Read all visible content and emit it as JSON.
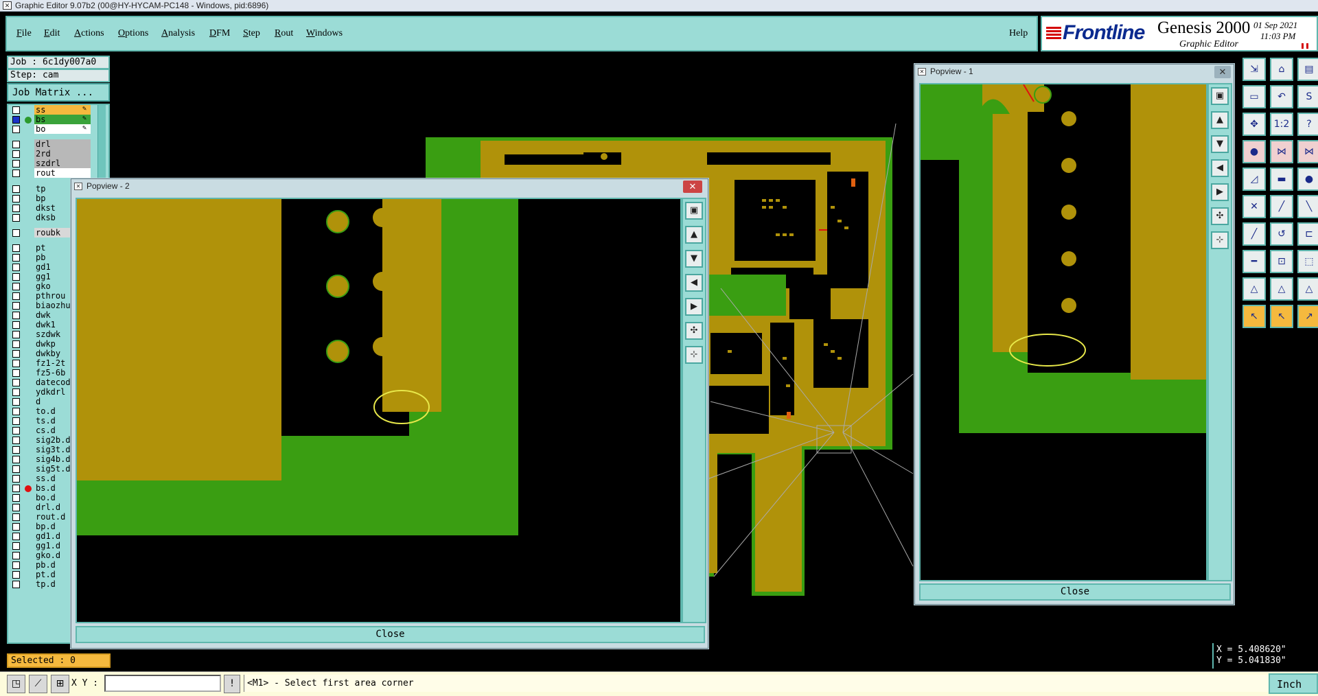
{
  "window": {
    "title": "Graphic Editor 9.07b2 (00@HY-HYCAM-PC148 - Windows, pid:6896)"
  },
  "menu": {
    "items": [
      {
        "label": "File",
        "u": "F",
        "rest": "ile"
      },
      {
        "label": "Edit",
        "u": "E",
        "rest": "dit"
      },
      {
        "label": "Actions",
        "u": "A",
        "rest": "ctions"
      },
      {
        "label": "Options",
        "u": "O",
        "rest": "ptions"
      },
      {
        "label": "Analysis",
        "u": "A",
        "rest": "nalysis"
      },
      {
        "label": "DFM",
        "u": "D",
        "rest": "FM"
      },
      {
        "label": "Step",
        "u": "S",
        "rest": "tep"
      },
      {
        "label": "Rout",
        "u": "R",
        "rest": "out"
      },
      {
        "label": "Windows",
        "u": "W",
        "rest": "indows"
      }
    ],
    "help": "Help"
  },
  "brand": {
    "logo": "Frontline",
    "product": "Genesis 2000",
    "subtitle": "Graphic Editor",
    "date": "01 Sep 2021",
    "time": "11:03 PM"
  },
  "job": {
    "job_line": "Job : 6c1dy007a0",
    "step_line": "Step: cam",
    "matrix_button": "Job Matrix ..."
  },
  "layers": [
    {
      "name": "ss",
      "bg": "#f5b93e",
      "dot": "",
      "edit": true
    },
    {
      "name": "bs",
      "bg": "#3aa33a",
      "dot": "#2c9a2c",
      "edit": true,
      "sel": true
    },
    {
      "name": "bo",
      "bg": "#ffffff",
      "dot": "",
      "edit": true
    },
    {
      "name": "drl",
      "bg": "#b8b8b8",
      "dot": ""
    },
    {
      "name": "2rd",
      "bg": "#b8b8b8",
      "dot": ""
    },
    {
      "name": "szdrl",
      "bg": "#b8b8b8",
      "dot": ""
    },
    {
      "name": "rout",
      "bg": "#ffffff",
      "dot": ""
    },
    {
      "name": "tp",
      "bg": "#9bdcd6",
      "dot": ""
    },
    {
      "name": "bp",
      "bg": "#9bdcd6",
      "dot": ""
    },
    {
      "name": "dkst",
      "bg": "#9bdcd6",
      "dot": ""
    },
    {
      "name": "dksb",
      "bg": "#9bdcd6",
      "dot": ""
    },
    {
      "name": "roubk",
      "bg": "#d8d8d8",
      "dot": ""
    },
    {
      "name": "pt",
      "bg": "#9bdcd6",
      "dot": ""
    },
    {
      "name": "pb",
      "bg": "#9bdcd6",
      "dot": ""
    },
    {
      "name": "gd1",
      "bg": "#9bdcd6",
      "dot": ""
    },
    {
      "name": "gg1",
      "bg": "#9bdcd6",
      "dot": ""
    },
    {
      "name": "gko",
      "bg": "#9bdcd6",
      "dot": ""
    },
    {
      "name": "pthrou",
      "bg": "#9bdcd6",
      "dot": ""
    },
    {
      "name": "biaozhu",
      "bg": "#9bdcd6",
      "dot": ""
    },
    {
      "name": "dwk",
      "bg": "#9bdcd6",
      "dot": ""
    },
    {
      "name": "dwk1",
      "bg": "#9bdcd6",
      "dot": ""
    },
    {
      "name": "szdwk",
      "bg": "#9bdcd6",
      "dot": ""
    },
    {
      "name": "dwkp",
      "bg": "#9bdcd6",
      "dot": ""
    },
    {
      "name": "dwkby",
      "bg": "#9bdcd6",
      "dot": ""
    },
    {
      "name": "fz1-2t",
      "bg": "#9bdcd6",
      "dot": ""
    },
    {
      "name": "fz5-6b",
      "bg": "#9bdcd6",
      "dot": ""
    },
    {
      "name": "datecod",
      "bg": "#9bdcd6",
      "dot": ""
    },
    {
      "name": "ydkdrl",
      "bg": "#9bdcd6",
      "dot": ""
    },
    {
      "name": "d",
      "bg": "#9bdcd6",
      "dot": ""
    },
    {
      "name": "to.d",
      "bg": "#9bdcd6",
      "dot": ""
    },
    {
      "name": "ts.d",
      "bg": "#9bdcd6",
      "dot": ""
    },
    {
      "name": "cs.d",
      "bg": "#9bdcd6",
      "dot": ""
    },
    {
      "name": "sig2b.d",
      "bg": "#9bdcd6",
      "dot": ""
    },
    {
      "name": "sig3t.d",
      "bg": "#9bdcd6",
      "dot": ""
    },
    {
      "name": "sig4b.d",
      "bg": "#9bdcd6",
      "dot": ""
    },
    {
      "name": "sig5t.d",
      "bg": "#9bdcd6",
      "dot": ""
    },
    {
      "name": "ss.d",
      "bg": "#9bdcd6",
      "dot": ""
    },
    {
      "name": "bs.d",
      "bg": "#9bdcd6",
      "dot": "#e01010"
    },
    {
      "name": "bo.d",
      "bg": "#9bdcd6",
      "dot": ""
    },
    {
      "name": "drl.d",
      "bg": "#9bdcd6",
      "dot": ""
    },
    {
      "name": "rout.d",
      "bg": "#9bdcd6",
      "dot": ""
    },
    {
      "name": "bp.d",
      "bg": "#9bdcd6",
      "dot": ""
    },
    {
      "name": "gd1.d",
      "bg": "#9bdcd6",
      "dot": ""
    },
    {
      "name": "gg1.d",
      "bg": "#9bdcd6",
      "dot": ""
    },
    {
      "name": "gko.d",
      "bg": "#9bdcd6",
      "dot": ""
    },
    {
      "name": "pb.d",
      "bg": "#9bdcd6",
      "dot": ""
    },
    {
      "name": "pt.d",
      "bg": "#9bdcd6",
      "dot": ""
    },
    {
      "name": "tp.d",
      "bg": "#9bdcd6",
      "dot": ""
    }
  ],
  "selected": "Selected : 0",
  "status": {
    "xy_label": "X Y :",
    "xy_value": "",
    "prompt": "<M1> - Select first area corner",
    "unit": "Inch",
    "info_button": "!"
  },
  "coords": {
    "x": "X = 5.408620\"",
    "y": "Y = 5.041830\""
  },
  "popview2": {
    "title": "Popview - 2",
    "close": "Close"
  },
  "popview1": {
    "title": "Popview - 1",
    "close": "Close"
  },
  "colors": {
    "copper": "#b0920a",
    "soldermask": "#3a9e12",
    "panel": "#9bdcd6",
    "border": "#5fb7ae",
    "highlight": "#e8e84a"
  },
  "toolbar_icons": [
    "window-icon",
    "zoom-in-icon",
    "zoom-out-icon",
    "pan-left-icon",
    "pan-right-icon",
    "fit-screen-icon",
    "fit-profile-icon"
  ]
}
